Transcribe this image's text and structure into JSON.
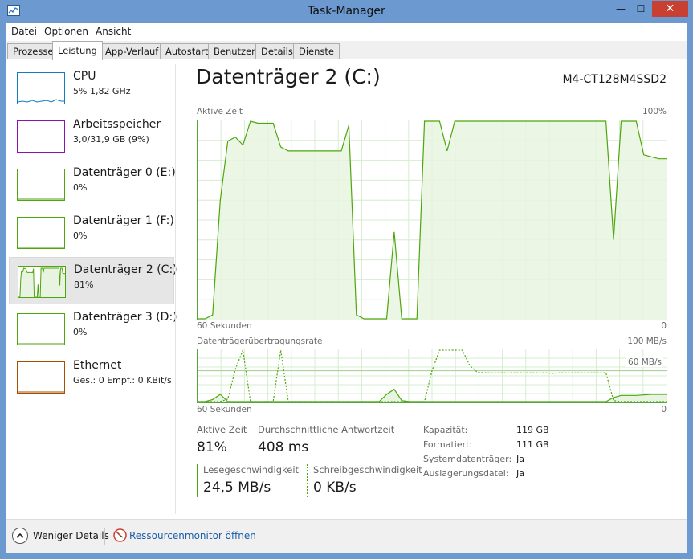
{
  "window": {
    "title": "Task-Manager",
    "controls": {
      "minimize": "—",
      "maximize": "☐",
      "close": "✕"
    }
  },
  "menubar": [
    "Datei",
    "Optionen",
    "Ansicht"
  ],
  "tabs": [
    "Prozesse",
    "Leistung",
    "App-Verlauf",
    "Autostart",
    "Benutzer",
    "Details",
    "Dienste"
  ],
  "active_tab": "Leistung",
  "sidebar": [
    {
      "title": "CPU",
      "sub": "5% 1,82 GHz",
      "color": "#117dbb"
    },
    {
      "title": "Arbeitsspeicher",
      "sub": "3,0/31,9 GB (9%)",
      "color": "#8b12ae"
    },
    {
      "title": "Datenträger 0 (E:)",
      "sub": "0%",
      "color": "#4da60c"
    },
    {
      "title": "Datenträger 1 (F:)",
      "sub": "0%",
      "color": "#4da60c"
    },
    {
      "title": "Datenträger 2 (C:)",
      "sub": "81%",
      "color": "#4da60c",
      "selected": true
    },
    {
      "title": "Datenträger 3 (D:)",
      "sub": "0%",
      "color": "#4da60c"
    },
    {
      "title": "Ethernet",
      "sub": "Ges.: 0 Empf.: 0 KBit/s",
      "color": "#a74f01"
    }
  ],
  "main": {
    "title": "Datenträger 2 (C:)",
    "model": "M4-CT128M4SSD2",
    "graph1": {
      "label": "Aktive Zeit",
      "max_label": "100%",
      "time_label": "60 Sekunden",
      "min_label": "0",
      "unit": "% active time",
      "points": [
        0,
        0,
        2,
        60,
        90,
        92,
        88,
        100,
        99,
        99,
        99,
        87,
        85,
        85,
        85,
        85,
        85,
        85,
        85,
        85,
        98,
        2,
        0,
        0,
        0,
        0,
        44,
        0,
        0,
        0,
        100,
        100,
        100,
        85,
        100,
        100,
        100,
        100,
        100,
        100,
        100,
        100,
        100,
        100,
        100,
        100,
        100,
        100,
        100,
        100,
        100,
        100,
        100,
        100,
        100,
        40,
        100,
        100,
        100,
        83,
        82,
        81,
        81
      ]
    },
    "graph2": {
      "label": "Datenträgerübertragungsrate",
      "max_label": "100 MB/s",
      "sub_max_label": "60 MB/s",
      "time_label": "60 Sekunden",
      "min_label": "0",
      "unit": "MB/s",
      "read_points": [
        0,
        0,
        4,
        14,
        0,
        0,
        0,
        0,
        0,
        0,
        0,
        0,
        0,
        0,
        0,
        0,
        0,
        0,
        0,
        0,
        0,
        0,
        0,
        0,
        0,
        14,
        24,
        2,
        0,
        0,
        0,
        0,
        0,
        0,
        0,
        0,
        0,
        0,
        0,
        0,
        0,
        0,
        0,
        0,
        0,
        0,
        0,
        0,
        0,
        0,
        0,
        0,
        0,
        0,
        0,
        8,
        12,
        12,
        12,
        13,
        14,
        14,
        14
      ],
      "write_points": [
        0,
        0,
        0,
        0,
        5,
        63,
        100,
        0,
        0,
        0,
        0,
        100,
        0,
        0,
        0,
        0,
        0,
        0,
        0,
        0,
        0,
        0,
        0,
        0,
        0,
        0,
        0,
        0,
        0,
        0,
        0,
        60,
        100,
        100,
        100,
        100,
        70,
        57,
        56,
        56,
        56,
        56,
        56,
        56,
        56,
        56,
        56,
        55,
        56,
        56,
        56,
        56,
        56,
        56,
        56,
        2,
        0,
        0,
        0,
        0,
        0,
        0,
        0
      ]
    },
    "stats": {
      "active_time_label": "Aktive Zeit",
      "active_time_value": "81%",
      "avg_response_label": "Durchschnittliche Antwortzeit",
      "avg_response_value": "408 ms",
      "read_speed_label": "Lesegeschwindigkeit",
      "read_speed_value": "24,5 MB/s",
      "write_speed_label": "Schreibgeschwindigkeit",
      "write_speed_value": "0 KB/s"
    },
    "properties": [
      {
        "label": "Kapazität:",
        "value": "119 GB"
      },
      {
        "label": "Formatiert:",
        "value": "111 GB"
      },
      {
        "label": "Systemdatenträger:",
        "value": "Ja"
      },
      {
        "label": "Auslagerungsdatei:",
        "value": "Ja"
      }
    ]
  },
  "footer": {
    "fewer_details": "Weniger Details",
    "resource_monitor": "Ressourcenmonitor öffnen"
  },
  "colors": {
    "disk_line": "#4da60c",
    "disk_fill": "#e8f4e1",
    "grid": "#d6ecd0",
    "accent": "#c84031"
  }
}
